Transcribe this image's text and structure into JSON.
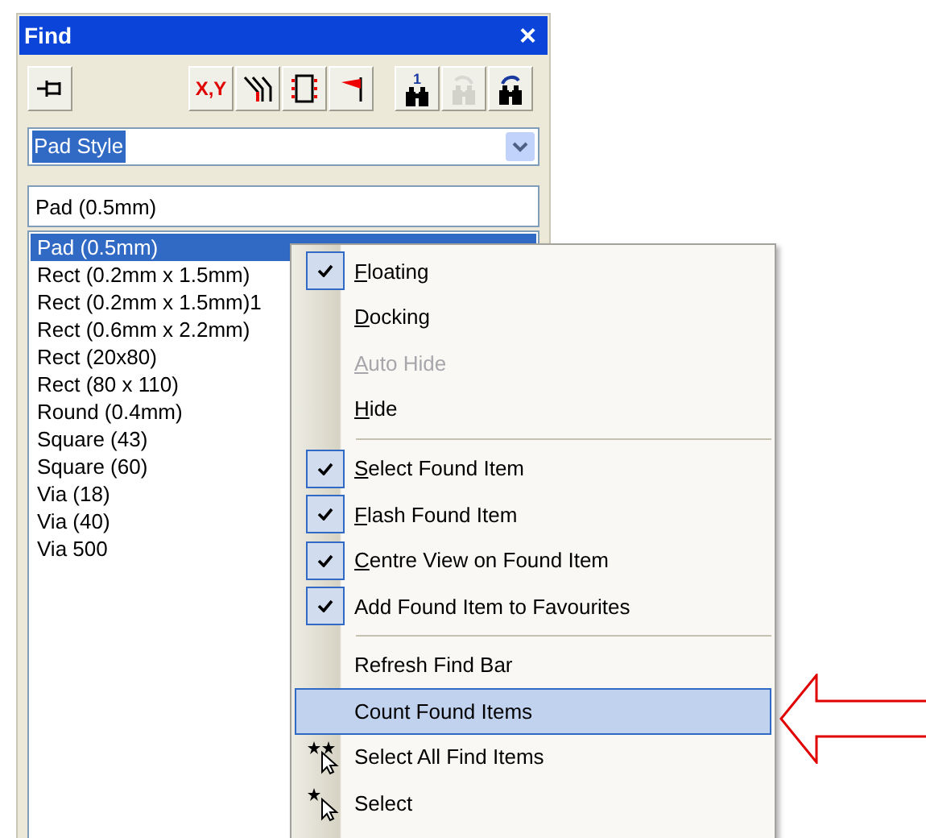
{
  "panel": {
    "title": "Find",
    "close": "×",
    "toolbar": [
      {
        "kind": "pin",
        "disabled": false
      },
      {
        "kind": "xy",
        "label": "X,Y",
        "disabled": false
      },
      {
        "kind": "tracks",
        "disabled": false
      },
      {
        "kind": "component",
        "disabled": false
      },
      {
        "kind": "flag",
        "disabled": false
      },
      {
        "kind": "find-first",
        "label": "1",
        "disabled": false
      },
      {
        "kind": "find-prev",
        "disabled": true
      },
      {
        "kind": "find-next",
        "disabled": false
      }
    ],
    "dropdown": {
      "value": "Pad Style"
    },
    "search": {
      "value": "Pad (0.5mm)"
    },
    "list": [
      {
        "label": "Pad (0.5mm)",
        "selected": true
      },
      {
        "label": "Rect (0.2mm x 1.5mm)",
        "selected": false
      },
      {
        "label": "Rect (0.2mm x 1.5mm)1",
        "selected": false
      },
      {
        "label": "Rect (0.6mm x 2.2mm)",
        "selected": false
      },
      {
        "label": "Rect (20x80)",
        "selected": false
      },
      {
        "label": "Rect (80 x 110)",
        "selected": false
      },
      {
        "label": "Round (0.4mm)",
        "selected": false
      },
      {
        "label": "Square (43)",
        "selected": false
      },
      {
        "label": "Square (60)",
        "selected": false
      },
      {
        "label": "Via (18)",
        "selected": false
      },
      {
        "label": "Via (40)",
        "selected": false
      },
      {
        "label": "Via 500",
        "selected": false
      }
    ]
  },
  "context_menu": [
    {
      "kind": "check",
      "label": "Floating",
      "checked": true,
      "disabled": false,
      "underline_first": true,
      "selected": false
    },
    {
      "kind": "check",
      "label": "Docking",
      "checked": false,
      "disabled": false,
      "underline_first": true,
      "selected": false
    },
    {
      "kind": "check",
      "label": "Auto Hide",
      "checked": false,
      "disabled": true,
      "underline_first": true,
      "selected": false
    },
    {
      "kind": "check",
      "label": "Hide",
      "checked": false,
      "disabled": false,
      "underline_first": true,
      "selected": false
    },
    {
      "kind": "separator"
    },
    {
      "kind": "check",
      "label": "Select Found Item",
      "checked": true,
      "disabled": false,
      "underline_first": true,
      "selected": false
    },
    {
      "kind": "check",
      "label": "Flash Found Item",
      "checked": true,
      "disabled": false,
      "underline_first": true,
      "selected": false
    },
    {
      "kind": "check",
      "label": "Centre View on Found Item",
      "checked": true,
      "disabled": false,
      "underline_first": true,
      "selected": false
    },
    {
      "kind": "check",
      "label": "Add Found Item to Favourites",
      "checked": true,
      "disabled": false,
      "underline_first": false,
      "selected": false
    },
    {
      "kind": "separator"
    },
    {
      "kind": "check",
      "label": "Refresh Find Bar",
      "checked": false,
      "disabled": false,
      "underline_first": false,
      "selected": false
    },
    {
      "kind": "check",
      "label": "Count Found Items",
      "checked": false,
      "disabled": false,
      "underline_first": false,
      "selected": true
    },
    {
      "kind": "stars2",
      "label": "Select All Find Items",
      "disabled": false,
      "underline_first": false,
      "selected": false
    },
    {
      "kind": "stars1",
      "label": "Select",
      "disabled": false,
      "underline_first": false,
      "selected": false
    }
  ]
}
